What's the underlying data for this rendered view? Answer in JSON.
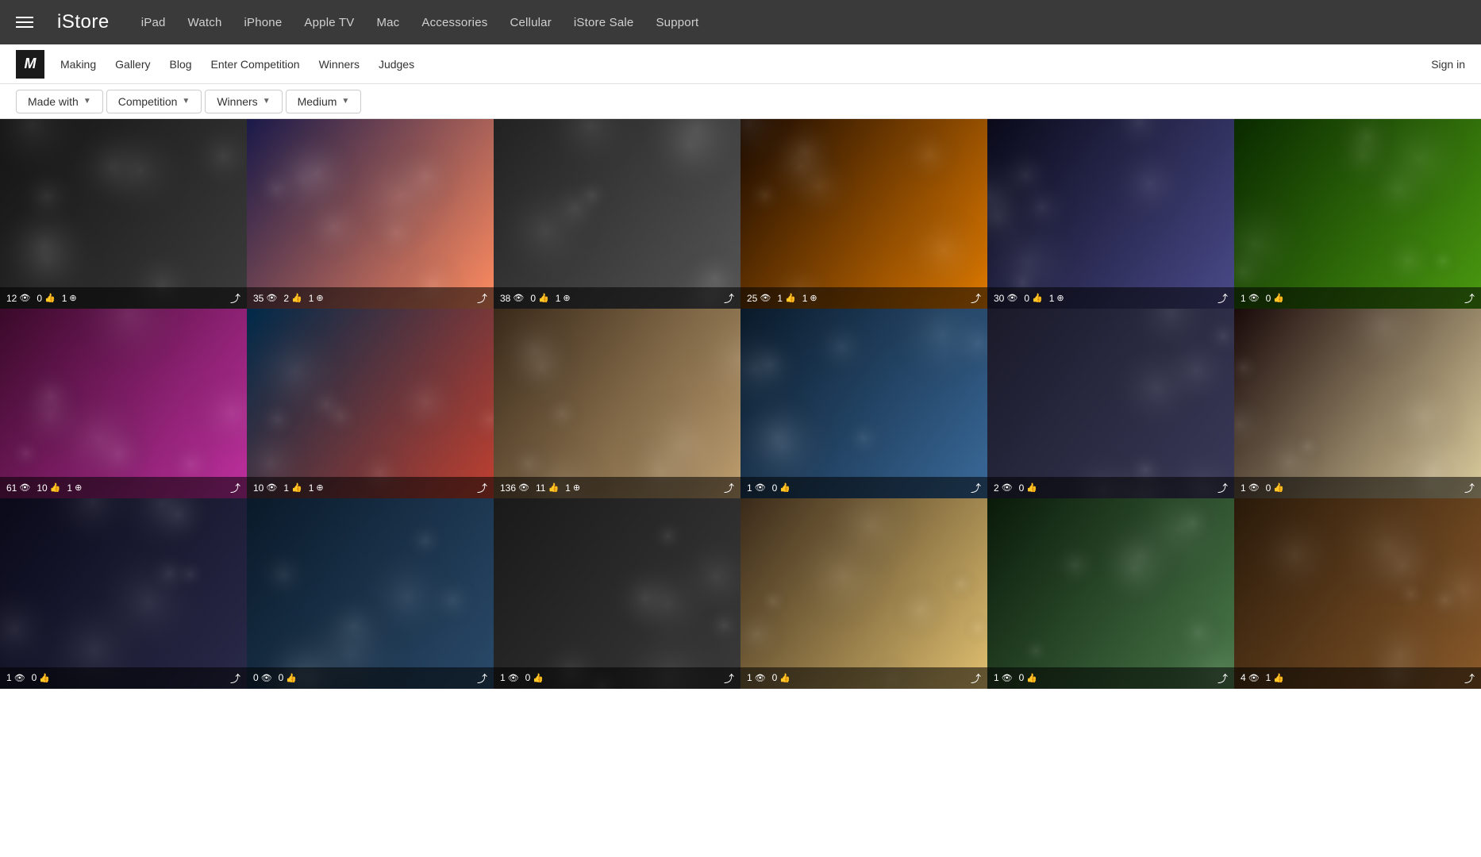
{
  "topNav": {
    "logo": "iStore",
    "hamburger_label": "Menu",
    "links": [
      {
        "label": "iPad",
        "href": "#"
      },
      {
        "label": "Watch",
        "href": "#"
      },
      {
        "label": "iPhone",
        "href": "#"
      },
      {
        "label": "Apple TV",
        "href": "#"
      },
      {
        "label": "Mac",
        "href": "#"
      },
      {
        "label": "Accessories",
        "href": "#"
      },
      {
        "label": "Cellular",
        "href": "#"
      },
      {
        "label": "iStore Sale",
        "href": "#"
      },
      {
        "label": "Support",
        "href": "#"
      }
    ]
  },
  "subNav": {
    "logo_char": "M",
    "links": [
      {
        "label": "Making",
        "href": "#"
      },
      {
        "label": "Gallery",
        "href": "#"
      },
      {
        "label": "Blog",
        "href": "#"
      },
      {
        "label": "Enter Competition",
        "href": "#"
      },
      {
        "label": "Winners",
        "href": "#"
      },
      {
        "label": "Judges",
        "href": "#"
      }
    ],
    "sign_in": "Sign in"
  },
  "filterBar": {
    "filters": [
      {
        "label": "Made with"
      },
      {
        "label": "Competition"
      },
      {
        "label": "Winners"
      },
      {
        "label": "Medium"
      }
    ]
  },
  "gallery": {
    "photos": [
      {
        "views": 12,
        "likes": 0,
        "entries": 1,
        "share": true,
        "colorClass": "cell-0"
      },
      {
        "views": 35,
        "likes": 2,
        "entries": 1,
        "share": true,
        "colorClass": "cell-1"
      },
      {
        "views": 38,
        "likes": 0,
        "entries": 1,
        "share": true,
        "colorClass": "cell-2"
      },
      {
        "views": 25,
        "likes": 1,
        "entries": 1,
        "share": true,
        "colorClass": "cell-3"
      },
      {
        "views": 30,
        "likes": 0,
        "entries": 1,
        "share": true,
        "colorClass": "cell-4"
      },
      {
        "views": 1,
        "likes": 0,
        "entries": 0,
        "share": true,
        "colorClass": "cell-5"
      },
      {
        "views": 61,
        "likes": 10,
        "entries": 1,
        "share": true,
        "colorClass": "cell-6"
      },
      {
        "views": 10,
        "likes": 1,
        "entries": 1,
        "share": true,
        "colorClass": "cell-7"
      },
      {
        "views": 136,
        "likes": 11,
        "entries": 1,
        "share": true,
        "colorClass": "cell-8"
      },
      {
        "views": 1,
        "likes": 0,
        "entries": 0,
        "share": true,
        "colorClass": "cell-9"
      },
      {
        "views": 2,
        "likes": 0,
        "entries": 0,
        "share": true,
        "colorClass": "cell-10"
      },
      {
        "views": 1,
        "likes": 0,
        "entries": 0,
        "share": true,
        "colorClass": "cell-11"
      },
      {
        "views": 1,
        "likes": 0,
        "entries": 0,
        "share": true,
        "colorClass": "cell-12"
      },
      {
        "views": 0,
        "likes": 0,
        "entries": 0,
        "share": true,
        "colorClass": "cell-13"
      },
      {
        "views": 1,
        "likes": 0,
        "entries": 0,
        "share": true,
        "colorClass": "cell-14"
      },
      {
        "views": 1,
        "likes": 0,
        "entries": 0,
        "share": true,
        "colorClass": "cell-15"
      },
      {
        "views": 1,
        "likes": 0,
        "entries": 0,
        "share": true,
        "colorClass": "cell-16"
      },
      {
        "views": 4,
        "likes": 1,
        "entries": 0,
        "share": true,
        "colorClass": "cell-17"
      }
    ]
  }
}
